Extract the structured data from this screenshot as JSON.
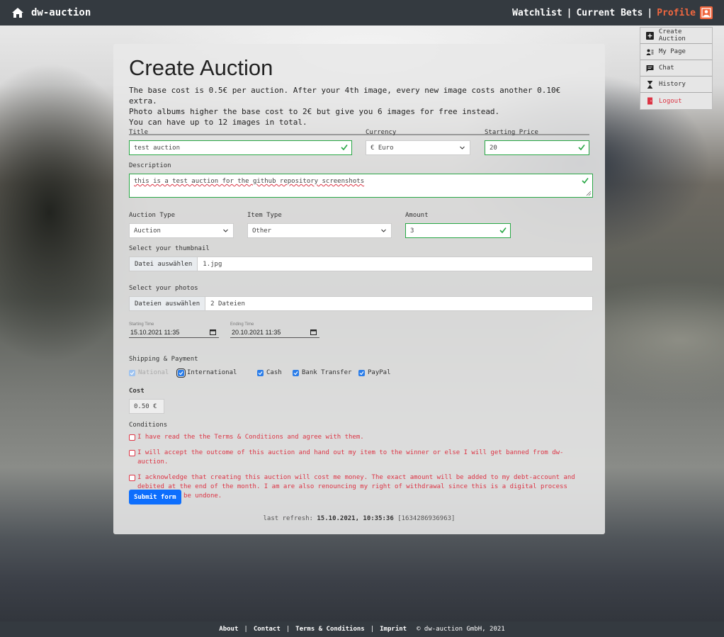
{
  "nav": {
    "brand": "dw-auction",
    "links": {
      "watchlist": "Watchlist",
      "current_bets": "Current Bets",
      "profile": "Profile"
    },
    "separator": "|"
  },
  "dropdown": {
    "items": [
      {
        "label": "Create Auction",
        "icon": "plus-square-icon"
      },
      {
        "label": "My Page",
        "icon": "person-lines-icon"
      },
      {
        "label": "Chat",
        "icon": "chat-icon"
      },
      {
        "label": "History",
        "icon": "hourglass-icon"
      },
      {
        "label": "Logout",
        "icon": "door-icon"
      }
    ]
  },
  "page": {
    "title": "Create Auction",
    "intro": [
      "The base cost is 0.5€ per auction. After your 4th image, every new image costs another 0.10€ extra.",
      "Photo albums higher the base cost to 2€ but give you 6 images for free instead.",
      "You can have up to 12 images in total."
    ]
  },
  "form": {
    "title_label": "Title",
    "title_value": "test auction",
    "currency_label": "Currency",
    "currency_value": "€ Euro",
    "price_label": "Starting Price",
    "price_value": "20",
    "description_label": "Description",
    "description_value": "this is a test auction for the github repository screenshots",
    "auction_type_label": "Auction Type",
    "auction_type_value": "Auction",
    "item_type_label": "Item Type",
    "item_type_value": "Other",
    "amount_label": "Amount",
    "amount_value": "3",
    "thumbnail_label": "Select your thumbnail",
    "thumbnail_button": "Datei auswählen",
    "thumbnail_file": "1.jpg",
    "photos_label": "Select your photos",
    "photos_button": "Dateien auswählen",
    "photos_file": "2 Dateien",
    "start_label": "Starting Time",
    "start_value": "15.10.2021 11:35",
    "end_label": "Ending Time",
    "end_value": "20.10.2021 11:35",
    "shipping_label": "Shipping & Payment",
    "shipping": {
      "national": "National",
      "international": "International",
      "cash": "Cash",
      "bank": "Bank Transfer",
      "paypal": "PayPal"
    },
    "cost_label": "Cost",
    "cost_value": "0.50 €",
    "conditions_label": "Conditions",
    "conditions": [
      "I have read the the Terms & Conditions and agree with them.",
      "I will accept the outcome of this auction and hand out my item to the winner or else I will get banned from dw-auction.",
      "I acknowledge that creating this auction will cost me money. The exact amount will be added to my debt-account and debited at the end of the month. I am are also renouncing my right of withdrawal since this is a digital process that cannot be undone."
    ],
    "submit": "Submit form"
  },
  "refresh": {
    "prefix": "last refresh:",
    "datetime": "15.10.2021, 10:35:36",
    "stamp": "[1634286936963]"
  },
  "footer": {
    "about": "About",
    "contact": "Contact",
    "terms": "Terms & Conditions",
    "imprint": "Imprint",
    "copyright": "© dw-auction GmbH, 2021",
    "separator": "|"
  },
  "colors": {
    "accent": "#f0673f",
    "valid": "#28a745",
    "danger": "#dc3545",
    "primary": "#0d6efd",
    "navbar": "#343a40"
  }
}
